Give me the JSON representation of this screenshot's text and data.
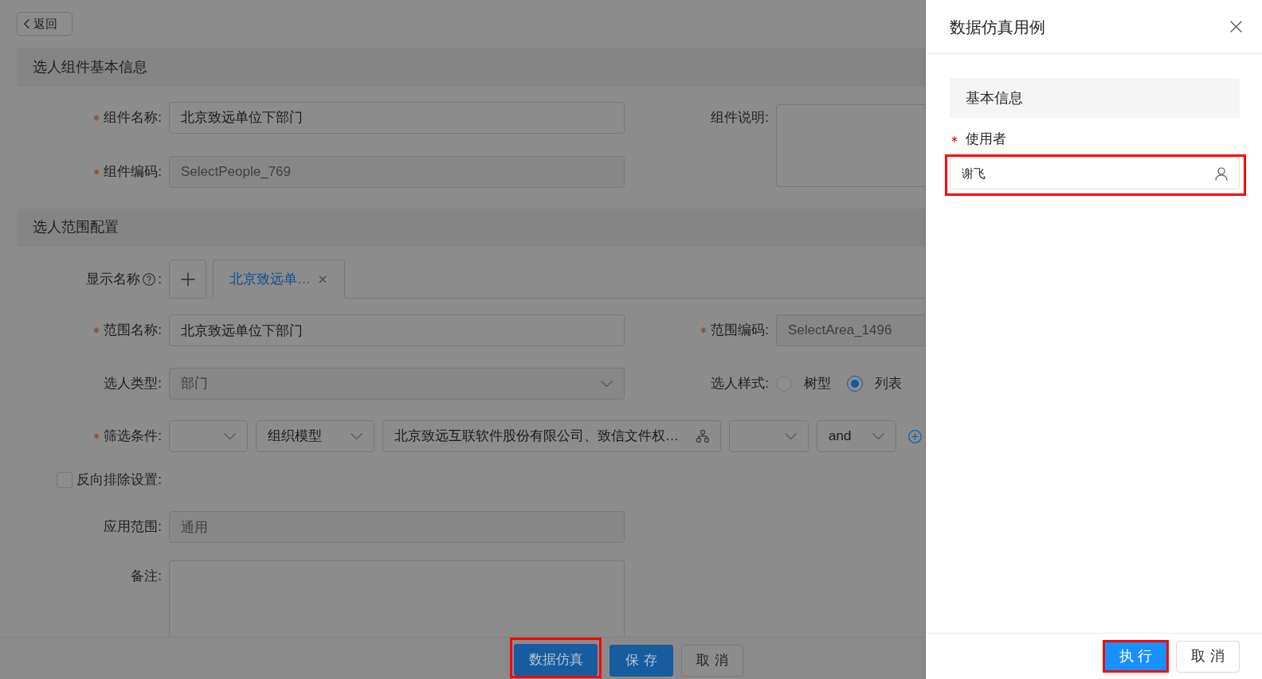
{
  "back_button": {
    "label": "返回"
  },
  "basic_section": {
    "title": "选人组件基本信息",
    "component_name": {
      "label": "组件名称:",
      "required": true,
      "value": "北京致远单位下部门",
      "disabled": false
    },
    "component_code": {
      "label": "组件编码:",
      "required": true,
      "value": "SelectPeople_769",
      "disabled": true
    },
    "description": {
      "label": "组件说明:",
      "required": false
    }
  },
  "range_section": {
    "title": "选人范围配置",
    "display_name": {
      "label": "显示名称",
      "label_suffix": ":",
      "tabs": [
        {
          "label": "北京致远单…",
          "selected": true
        }
      ]
    },
    "range_name": {
      "label": "范围名称:",
      "required": true,
      "value": "北京致远单位下部门",
      "disabled": false
    },
    "range_code": {
      "label": "范围编码:",
      "required": true,
      "value": "SelectArea_1496",
      "disabled": true
    },
    "select_type": {
      "label": "选人类型:",
      "required": false,
      "value": "部门",
      "disabled": true
    },
    "select_style": {
      "label": "选人样式:",
      "options": [
        {
          "label": "树型",
          "selected": false
        },
        {
          "label": "列表",
          "selected": true
        }
      ]
    },
    "filter": {
      "label": "筛选条件:",
      "required": true,
      "controls": [
        {
          "kind": "select"
        },
        {
          "kind": "select",
          "value": "组织模型"
        },
        {
          "kind": "picker",
          "value": "北京致远互联软件股份有限公司、致信文件权…"
        },
        {
          "kind": "select"
        },
        {
          "kind": "select",
          "value": "and"
        }
      ]
    },
    "reverse_exclude": {
      "label": "反向排除设置:",
      "checked": false
    },
    "scope": {
      "label": "应用范围:",
      "required": false,
      "value": "通用",
      "disabled": true
    },
    "remark": {
      "label": "备注:",
      "required": false
    }
  },
  "footer_buttons": [
    {
      "label": "数据仿真",
      "kind": "primary",
      "highlighted": true
    },
    {
      "label": "保存",
      "kind": "primary",
      "highlighted": false
    },
    {
      "label": "取消",
      "kind": "default",
      "highlighted": false
    }
  ],
  "drawer": {
    "title": "数据仿真用例",
    "section_title": "基本信息",
    "user_field": {
      "label": "使用者",
      "required": true,
      "value": "谢飞",
      "highlighted": true
    },
    "buttons": [
      {
        "label": "执行",
        "kind": "primary",
        "highlighted": true
      },
      {
        "label": "取消",
        "kind": "default",
        "highlighted": false
      }
    ]
  }
}
